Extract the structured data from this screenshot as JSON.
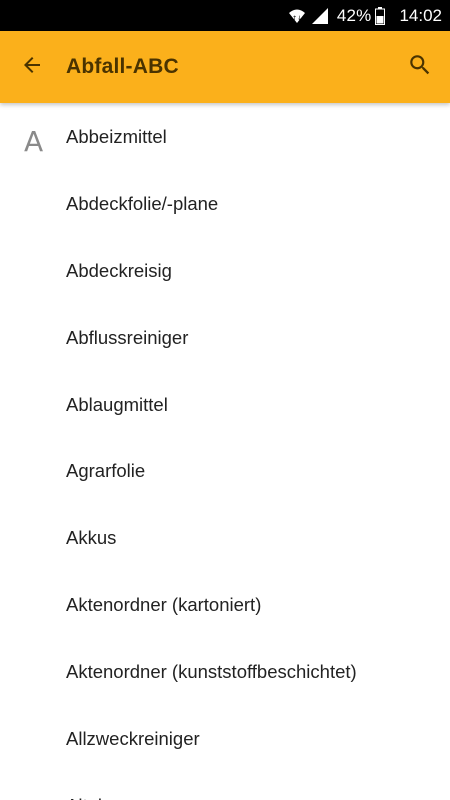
{
  "status_bar": {
    "battery_percent": "42%",
    "time": "14:02",
    "icons": [
      "wifi-icon",
      "signal-icon",
      "battery-icon"
    ]
  },
  "app_bar": {
    "title": "Abfall-ABC",
    "back_icon": "arrow-left-icon",
    "search_icon": "search-icon",
    "background_color": "#fbb01b"
  },
  "list": {
    "section_letter": "A",
    "items": [
      "Abbeizmittel",
      "Abdeckfolie/-plane",
      "Abdeckreisig",
      "Abflussreiniger",
      "Ablaugmittel",
      "Agrarfolie",
      "Akkus",
      "Aktenordner (kartoniert)",
      "Aktenordner (kunststoffbeschichtet)",
      "Allzweckreiniger",
      "Altei..."
    ]
  }
}
